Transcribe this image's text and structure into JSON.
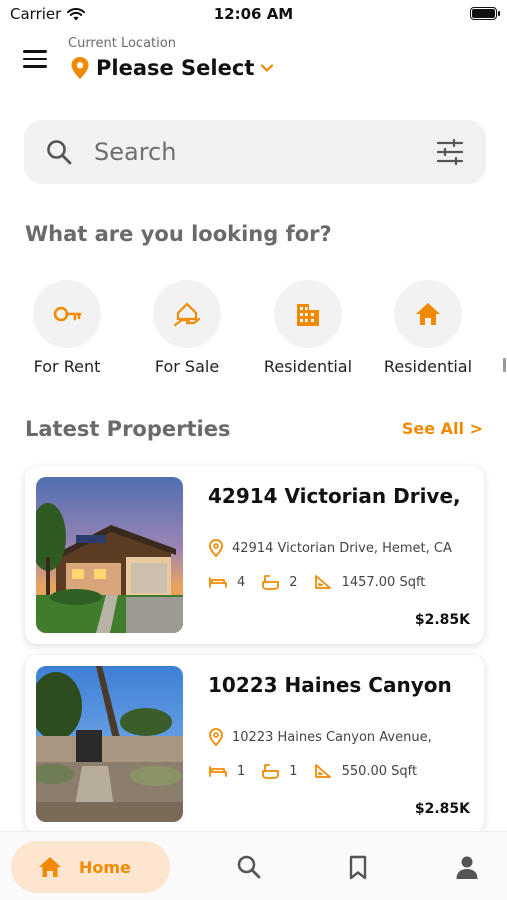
{
  "status_bar": {
    "carrier": "Carrier",
    "time": "12:06 AM"
  },
  "header": {
    "location_caption": "Current Location",
    "location_value": "Please Select"
  },
  "search": {
    "placeholder": "Search"
  },
  "categories_title": "What are you looking for?",
  "categories": [
    {
      "label": "For Rent",
      "icon": "key-icon"
    },
    {
      "label": "For Sale",
      "icon": "house-hand-icon"
    },
    {
      "label": "Residential",
      "icon": "building-icon"
    },
    {
      "label": "Residential",
      "icon": "home-icon"
    }
  ],
  "latest": {
    "title": "Latest Properties",
    "see_all": "See All >",
    "properties": [
      {
        "title": "42914 Victorian Drive,",
        "address": "42914 Victorian Drive, Hemet, CA",
        "beds": "4",
        "baths": "2",
        "area": "1457.00 Sqft",
        "price": "$2.85K"
      },
      {
        "title": "10223 Haines Canyon",
        "address": "10223 Haines Canyon Avenue,",
        "beds": "1",
        "baths": "1",
        "area": "550.00 Sqft",
        "price": "$2.85K"
      }
    ]
  },
  "nav": {
    "home_label": "Home"
  },
  "colors": {
    "accent": "#f08a00",
    "accent_soft": "#fde6cf",
    "surface": "#f2f2f2"
  }
}
